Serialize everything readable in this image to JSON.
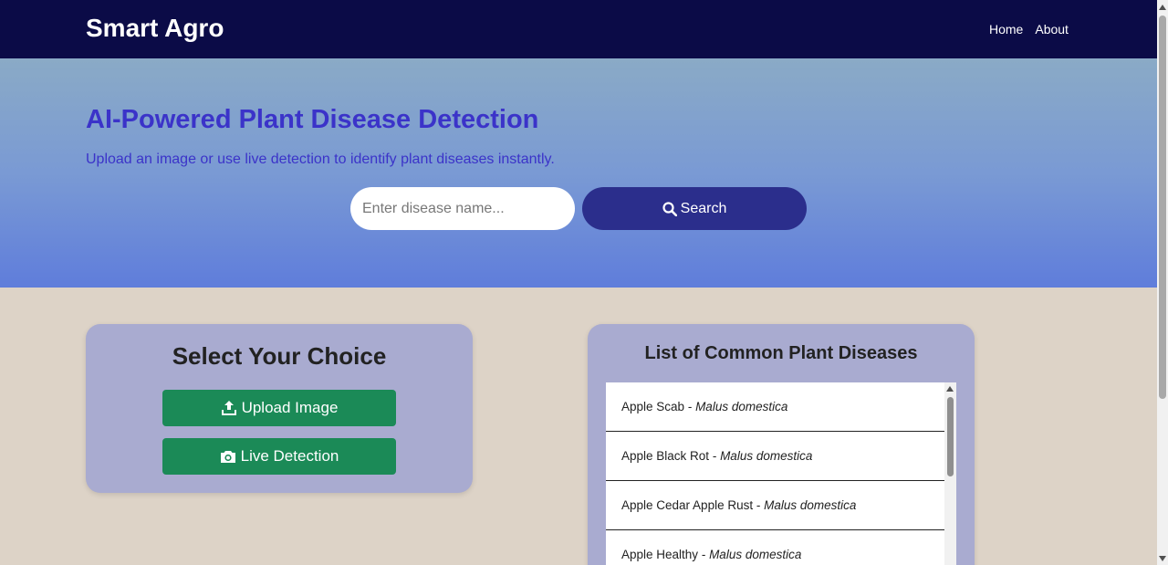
{
  "navbar": {
    "brand": "Smart Agro",
    "links": [
      "Home",
      "About"
    ]
  },
  "hero": {
    "title": "AI-Powered Plant Disease Detection",
    "subtitle": "Upload an image or use live detection to identify plant diseases instantly.",
    "search_placeholder": "Enter disease name...",
    "search_button": "Search"
  },
  "choice": {
    "title": "Select Your Choice",
    "upload_label": "Upload Image",
    "live_label": "Live Detection"
  },
  "diseases": {
    "title": "List of Common Plant Diseases",
    "items": [
      {
        "name": "Apple Scab",
        "sep": " - ",
        "scientific": "Malus domestica"
      },
      {
        "name": "Apple Black Rot",
        "sep": " - ",
        "scientific": "Malus domestica"
      },
      {
        "name": "Apple Cedar Apple Rust",
        "sep": " - ",
        "scientific": "Malus domestica"
      },
      {
        "name": "Apple Healthy",
        "sep": " - ",
        "scientific": "Malus domestica"
      }
    ]
  },
  "colors": {
    "navbar": "#0b0b47",
    "hero_text": "#3b33c9",
    "search_button": "#2b2e8c",
    "green_button": "#1b8a57",
    "card": "#a9abd0",
    "page_bg": "#ddd3c7"
  },
  "icons": {
    "search": "magnifier-icon",
    "upload": "upload-icon",
    "live": "camera-icon"
  }
}
